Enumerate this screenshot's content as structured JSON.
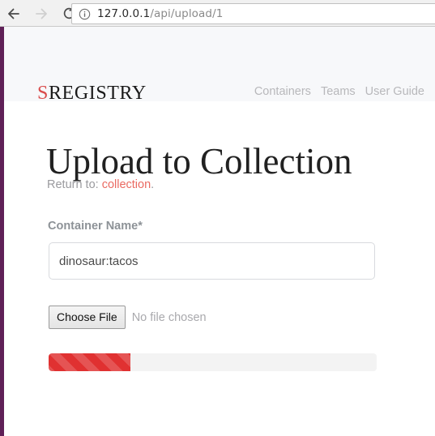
{
  "browser": {
    "back_icon": "back-arrow-icon",
    "forward_icon": "forward-arrow-icon",
    "reload_icon": "reload-icon",
    "site_info_icon": "info-circle-icon",
    "url_host": "127.0.0.1",
    "url_path": "/api/upload/1",
    "url_full": "127.0.0.1/api/upload/1"
  },
  "site": {
    "brand_first_letter": "S",
    "brand_rest": "REGISTRY",
    "accent_rail_color": "#5f2057",
    "nav_links": [
      {
        "label": "Containers"
      },
      {
        "label": "Teams"
      },
      {
        "label": "User Guide"
      }
    ]
  },
  "main": {
    "title": "Upload to Collection",
    "return_prefix": "Return to: ",
    "return_link_label": "collection",
    "return_suffix": ".",
    "form": {
      "container_name_label": "Container Name*",
      "container_name_value": "dinosaur:tacos",
      "container_name_placeholder": "",
      "choose_file_label": "Choose File",
      "no_file_text": "No file chosen"
    },
    "progress": {
      "percent": 25,
      "fill_width": "25%",
      "color": "#e03131",
      "track_color": "#f3f3f3",
      "striped": "true"
    }
  }
}
